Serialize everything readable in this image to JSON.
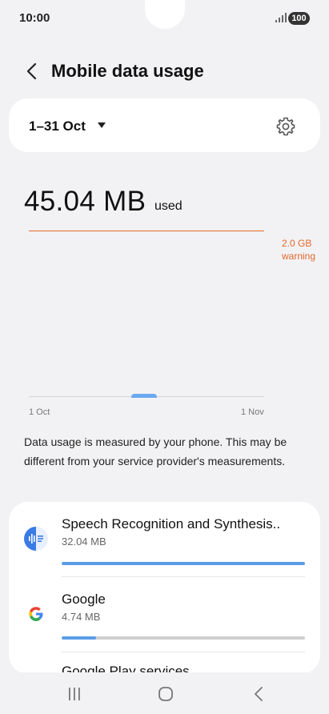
{
  "status": {
    "time": "10:00",
    "battery": "100",
    "icons": [
      "signal-icon"
    ]
  },
  "header": {
    "title": "Mobile data usage",
    "back_icon": "chevron-left-icon"
  },
  "period": {
    "range": "1–31 Oct",
    "dropdown_icon": "caret-down-icon",
    "settings_icon": "gear-icon"
  },
  "usage": {
    "amount": "45.04 MB",
    "unit": "used"
  },
  "chart_data": {
    "type": "area",
    "x_labels": [
      "1 Oct",
      "1 Nov"
    ],
    "warning": {
      "value_gb": 2.0,
      "label_line1": "2.0 GB",
      "label_line2": "warning"
    },
    "total_used_mb": 45.04,
    "colors": {
      "warning": "#e2692e",
      "usage": "#6aa8f0"
    }
  },
  "info": {
    "text": "Data usage is measured by your phone. This may be different from your service provider's measurements."
  },
  "apps": [
    {
      "name": "Speech Recognition and Synthesis..",
      "size": "32.04 MB",
      "fraction": 1.0,
      "icon": "speech-recognition-icon"
    },
    {
      "name": "Google",
      "size": "4.74 MB",
      "fraction": 0.14,
      "icon": "google-icon"
    },
    {
      "name": "Google Play services",
      "size": "",
      "fraction": 0.1,
      "icon": "google-play-services-icon"
    }
  ],
  "nav": {
    "icons": [
      "recent-apps-icon",
      "home-icon",
      "back-icon"
    ]
  }
}
